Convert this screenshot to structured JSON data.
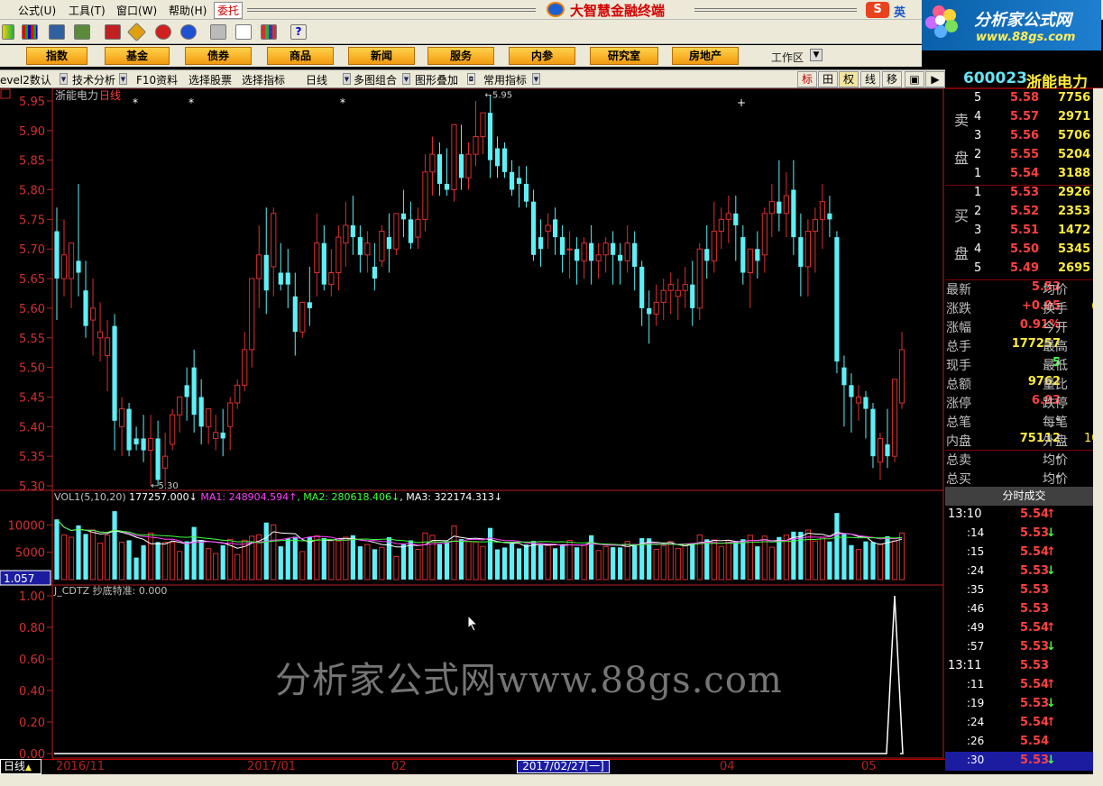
{
  "menu": {
    "items": [
      "公式(U)",
      "工具(T)",
      "窗口(W)",
      "帮助(H)"
    ],
    "wt_btn": "委托",
    "app_title": "大智慧金融终端"
  },
  "ime": {
    "ying": "英"
  },
  "logo": {
    "title": "分析家公式网",
    "url": "www.88gs.com"
  },
  "nav": {
    "buttons": [
      "指数",
      "基金",
      "债券",
      "商品",
      "新闻",
      "服务",
      "内参",
      "研究室",
      "房地产"
    ],
    "workarea": "工作区"
  },
  "sub": {
    "items": [
      "evel2数认",
      "技术分析",
      "F10资料",
      "选择股票",
      "选择指标",
      "日线",
      "多图组合",
      "图形叠加",
      "常用指标"
    ],
    "right": [
      "标",
      "田",
      "权",
      "线",
      "移"
    ]
  },
  "stock": {
    "code": "600023",
    "name": "浙能电力"
  },
  "chart_title": {
    "name": "浙能电力",
    "period": "日线"
  },
  "orderbook": {
    "sell_label": [
      "卖",
      "盘"
    ],
    "buy_label": [
      "买",
      "盘"
    ],
    "sell": [
      {
        "lvl": "5",
        "price": "5.58",
        "vol": "7756"
      },
      {
        "lvl": "4",
        "price": "5.57",
        "vol": "2971"
      },
      {
        "lvl": "3",
        "price": "5.56",
        "vol": "5706"
      },
      {
        "lvl": "2",
        "price": "5.55",
        "vol": "5204"
      },
      {
        "lvl": "1",
        "price": "5.54",
        "vol": "3188"
      }
    ],
    "buy": [
      {
        "lvl": "1",
        "price": "5.53",
        "vol": "2926"
      },
      {
        "lvl": "2",
        "price": "5.52",
        "vol": "2353"
      },
      {
        "lvl": "3",
        "price": "5.51",
        "vol": "1472"
      },
      {
        "lvl": "4",
        "price": "5.50",
        "vol": "5345"
      },
      {
        "lvl": "5",
        "price": "5.49",
        "vol": "2695"
      }
    ]
  },
  "quote": [
    {
      "l": "最新",
      "v": "5.53",
      "c": "#ff4040",
      "r": "均价"
    },
    {
      "l": "涨跌",
      "v": "+0.05",
      "c": "#ff4040",
      "r": "换手"
    },
    {
      "l": "涨幅",
      "v": "0.91%",
      "c": "#ff4040",
      "r": "今开"
    },
    {
      "l": "总手",
      "v": "177257",
      "c": "#ffeb3b",
      "r": "最高"
    },
    {
      "l": "现手",
      "v": "5",
      "c": "#4cff4c",
      "r": "最低"
    },
    {
      "l": "总额",
      "v": "9762",
      "c": "#ffeb3b",
      "r": "量比"
    },
    {
      "l": "涨停",
      "v": "6.03",
      "c": "#ff4040",
      "r": "跌停"
    },
    {
      "l": "总笔",
      "v": "-",
      "c": "#c0c0c0",
      "r": "每笔"
    },
    {
      "l": "内盘",
      "v": "75112",
      "c": "#ffeb3b",
      "r": "外盘"
    },
    {
      "l": "总卖",
      "v": "-",
      "c": "#c0c0c0",
      "r": "均价"
    },
    {
      "l": "总买",
      "v": "-",
      "c": "#c0c0c0",
      "r": "均价"
    }
  ],
  "quote_extra": {
    "r2": "(",
    "r9": "10"
  },
  "ticks": {
    "header": "分时成交",
    "rows": [
      {
        "t": "13:10",
        "p": "5.54",
        "d": "up",
        "big": true
      },
      {
        "t": ":14",
        "p": "5.53",
        "d": "dn"
      },
      {
        "t": ":15",
        "p": "5.54",
        "d": "up"
      },
      {
        "t": ":24",
        "p": "5.53",
        "d": "dn"
      },
      {
        "t": ":35",
        "p": "5.53",
        "d": ""
      },
      {
        "t": ":46",
        "p": "5.53",
        "d": ""
      },
      {
        "t": ":49",
        "p": "5.54",
        "d": "up"
      },
      {
        "t": ":57",
        "p": "5.53",
        "d": "dn"
      },
      {
        "t": "13:11",
        "p": "5.53",
        "d": "",
        "big": true
      },
      {
        "t": ":11",
        "p": "5.54",
        "d": "up"
      },
      {
        "t": ":19",
        "p": "5.53",
        "d": "dn"
      },
      {
        "t": ":24",
        "p": "5.54",
        "d": "up"
      },
      {
        "t": ":26",
        "p": "5.54",
        "d": ""
      },
      {
        "t": ":30",
        "p": "5.53",
        "d": "dn"
      }
    ]
  },
  "indicators": {
    "vol_label": "VOL1(5,10,20)",
    "vol_value": "177257.000",
    "ma1": "MA1: 248904.594",
    "ma2": "MA2: 280618.406",
    "ma3": "MA3: 322174.313",
    "vol_badge": "1.057",
    "cdtz_label": "J_CDTZ",
    "cdtz_text": "抄底特准: 0.000"
  },
  "axis": {
    "price_ticks": [
      "5.95",
      "5.90",
      "5.85",
      "5.80",
      "5.75",
      "5.70",
      "5.65",
      "5.60",
      "5.55",
      "5.50",
      "5.45",
      "5.40",
      "5.35",
      "5.30"
    ],
    "vol_ticks": [
      "10000",
      "5000"
    ],
    "ind_ticks": [
      "1.00",
      "0.80",
      "0.60",
      "0.40",
      "0.20",
      "0.00"
    ],
    "hi_mark": "5.95",
    "lo_mark": "5.30"
  },
  "bottom": {
    "day": "日线",
    "dates": [
      "2016/11",
      "2017/01",
      "02",
      "2017/02/27[一]",
      "04",
      "05"
    ]
  },
  "watermark": "分析家公式网www.88gs.com",
  "chart_data": {
    "type": "candlestick",
    "price_range": [
      5.3,
      5.95
    ],
    "candles": [
      [
        5.73,
        5.77,
        5.65,
        5.58
      ],
      [
        5.65,
        5.75,
        5.69,
        5.62
      ],
      [
        5.65,
        5.7,
        5.71,
        5.6
      ],
      [
        5.68,
        5.81,
        5.66,
        5.62
      ],
      [
        5.63,
        5.68,
        5.57,
        5.55
      ],
      [
        5.58,
        5.65,
        5.6,
        5.52
      ],
      [
        5.55,
        5.61,
        5.56,
        5.51
      ],
      [
        5.52,
        5.58,
        5.55,
        5.46
      ],
      [
        5.57,
        5.59,
        5.41,
        5.36
      ],
      [
        5.4,
        5.45,
        5.43,
        5.35
      ],
      [
        5.43,
        5.44,
        5.36,
        5.35
      ],
      [
        5.38,
        5.4,
        5.37,
        5.36
      ],
      [
        5.38,
        5.42,
        5.36,
        5.34
      ],
      [
        5.36,
        5.42,
        5.38,
        5.3
      ],
      [
        5.38,
        5.41,
        5.31,
        5.3
      ],
      [
        5.33,
        5.39,
        5.35,
        5.3
      ],
      [
        5.37,
        5.43,
        5.42,
        5.36
      ],
      [
        5.42,
        5.45,
        5.45,
        5.39
      ],
      [
        5.47,
        5.5,
        5.45,
        5.41
      ],
      [
        5.5,
        5.53,
        5.42,
        5.39
      ],
      [
        5.45,
        5.48,
        5.4,
        5.37
      ],
      [
        5.4,
        5.42,
        5.43,
        5.37
      ],
      [
        5.38,
        5.42,
        5.39,
        5.36
      ],
      [
        5.39,
        5.43,
        5.38,
        5.35
      ],
      [
        5.4,
        5.45,
        5.44,
        5.36
      ],
      [
        5.44,
        5.48,
        5.47,
        5.43
      ],
      [
        5.47,
        5.56,
        5.53,
        5.46
      ],
      [
        5.53,
        5.6,
        5.65,
        5.5
      ],
      [
        5.65,
        5.74,
        5.69,
        5.6
      ],
      [
        5.69,
        5.77,
        5.63,
        5.59
      ],
      [
        5.67,
        5.77,
        5.76,
        5.62
      ],
      [
        5.66,
        5.71,
        5.64,
        5.63
      ],
      [
        5.66,
        5.7,
        5.64,
        5.6
      ],
      [
        5.62,
        5.66,
        5.56,
        5.52
      ],
      [
        5.56,
        5.6,
        5.61,
        5.55
      ],
      [
        5.61,
        5.67,
        5.6,
        5.57
      ],
      [
        5.66,
        5.76,
        5.71,
        5.62
      ],
      [
        5.71,
        5.74,
        5.64,
        5.63
      ],
      [
        5.64,
        5.7,
        5.66,
        5.62
      ],
      [
        5.66,
        5.74,
        5.72,
        5.63
      ],
      [
        5.71,
        5.78,
        5.74,
        5.67
      ],
      [
        5.74,
        5.79,
        5.72,
        5.69
      ],
      [
        5.72,
        5.74,
        5.69,
        5.66
      ],
      [
        5.69,
        5.73,
        5.71,
        5.66
      ],
      [
        5.67,
        5.71,
        5.65,
        5.63
      ],
      [
        5.68,
        5.74,
        5.73,
        5.67
      ],
      [
        5.72,
        5.76,
        5.7,
        5.66
      ],
      [
        5.7,
        5.73,
        5.76,
        5.69
      ],
      [
        5.76,
        5.8,
        5.75,
        5.72
      ],
      [
        5.75,
        5.78,
        5.71,
        5.7
      ],
      [
        5.72,
        5.77,
        5.75,
        5.7
      ],
      [
        5.75,
        5.86,
        5.83,
        5.73
      ],
      [
        5.83,
        5.89,
        5.86,
        5.79
      ],
      [
        5.86,
        5.88,
        5.81,
        5.79
      ],
      [
        5.81,
        5.87,
        5.8,
        5.79
      ],
      [
        5.8,
        5.9,
        5.91,
        5.78
      ],
      [
        5.86,
        5.91,
        5.82,
        5.8
      ],
      [
        5.82,
        5.88,
        5.86,
        5.8
      ],
      [
        5.86,
        5.95,
        5.89,
        5.84
      ],
      [
        5.89,
        5.93,
        5.93,
        5.86
      ],
      [
        5.93,
        5.96,
        5.85,
        5.82
      ],
      [
        5.87,
        5.89,
        5.84,
        5.82
      ],
      [
        5.87,
        5.88,
        5.83,
        5.82
      ],
      [
        5.83,
        5.85,
        5.8,
        5.79
      ],
      [
        5.82,
        5.84,
        5.81,
        5.77
      ],
      [
        5.81,
        5.84,
        5.78,
        5.77
      ],
      [
        5.78,
        5.8,
        5.69,
        5.68
      ],
      [
        5.72,
        5.75,
        5.7,
        5.67
      ],
      [
        5.73,
        5.76,
        5.74,
        5.7
      ],
      [
        5.75,
        5.77,
        5.72,
        5.69
      ],
      [
        5.72,
        5.74,
        5.69,
        5.66
      ],
      [
        5.7,
        5.73,
        5.7,
        5.65
      ],
      [
        5.7,
        5.72,
        5.68,
        5.64
      ],
      [
        5.68,
        5.72,
        5.71,
        5.65
      ],
      [
        5.71,
        5.74,
        5.68,
        5.64
      ],
      [
        5.68,
        5.71,
        5.69,
        5.65
      ],
      [
        5.69,
        5.72,
        5.71,
        5.66
      ],
      [
        5.71,
        5.73,
        5.69,
        5.64
      ],
      [
        5.69,
        5.71,
        5.68,
        5.64
      ],
      [
        5.68,
        5.74,
        5.71,
        5.66
      ],
      [
        5.71,
        5.73,
        5.67,
        5.63
      ],
      [
        5.67,
        5.68,
        5.6,
        5.57
      ],
      [
        5.6,
        5.63,
        5.59,
        5.54
      ],
      [
        5.59,
        5.64,
        5.61,
        5.57
      ],
      [
        5.61,
        5.65,
        5.63,
        5.58
      ],
      [
        5.63,
        5.66,
        5.64,
        5.59
      ],
      [
        5.62,
        5.65,
        5.63,
        5.58
      ],
      [
        5.63,
        5.67,
        5.64,
        5.6
      ],
      [
        5.64,
        5.68,
        5.6,
        5.57
      ],
      [
        5.6,
        5.71,
        5.7,
        5.58
      ],
      [
        5.7,
        5.74,
        5.68,
        5.65
      ],
      [
        5.68,
        5.78,
        5.73,
        5.66
      ],
      [
        5.73,
        5.77,
        5.75,
        5.7
      ],
      [
        5.75,
        5.79,
        5.76,
        5.71
      ],
      [
        5.76,
        5.79,
        5.74,
        5.68
      ],
      [
        5.72,
        5.74,
        5.66,
        5.64
      ],
      [
        5.66,
        5.7,
        5.7,
        5.6
      ],
      [
        5.7,
        5.73,
        5.68,
        5.65
      ],
      [
        5.69,
        5.77,
        5.76,
        5.66
      ],
      [
        5.76,
        5.81,
        5.78,
        5.72
      ],
      [
        5.78,
        5.85,
        5.76,
        5.73
      ],
      [
        5.76,
        5.83,
        5.79,
        5.72
      ],
      [
        5.8,
        5.85,
        5.72,
        5.69
      ],
      [
        5.72,
        5.76,
        5.67,
        5.62
      ],
      [
        5.67,
        5.75,
        5.73,
        5.62
      ],
      [
        5.73,
        5.77,
        5.75,
        5.66
      ],
      [
        5.75,
        5.81,
        5.78,
        5.7
      ],
      [
        5.76,
        5.79,
        5.75,
        5.72
      ],
      [
        5.72,
        5.73,
        5.51,
        5.49
      ],
      [
        5.5,
        5.52,
        5.47,
        5.4
      ],
      [
        5.47,
        5.49,
        5.45,
        5.39
      ],
      [
        5.44,
        5.47,
        5.45,
        5.41
      ],
      [
        5.45,
        5.46,
        5.43,
        5.38
      ],
      [
        5.43,
        5.44,
        5.35,
        5.33
      ],
      [
        5.34,
        5.39,
        5.38,
        5.31
      ],
      [
        5.37,
        5.43,
        5.35,
        5.33
      ],
      [
        5.35,
        5.45,
        5.48,
        5.34
      ],
      [
        5.44,
        5.56,
        5.53,
        5.43
      ]
    ],
    "vol_ma_series": [
      "MA1",
      "MA2",
      "MA3"
    ],
    "cdtz_peak": 1.0
  }
}
